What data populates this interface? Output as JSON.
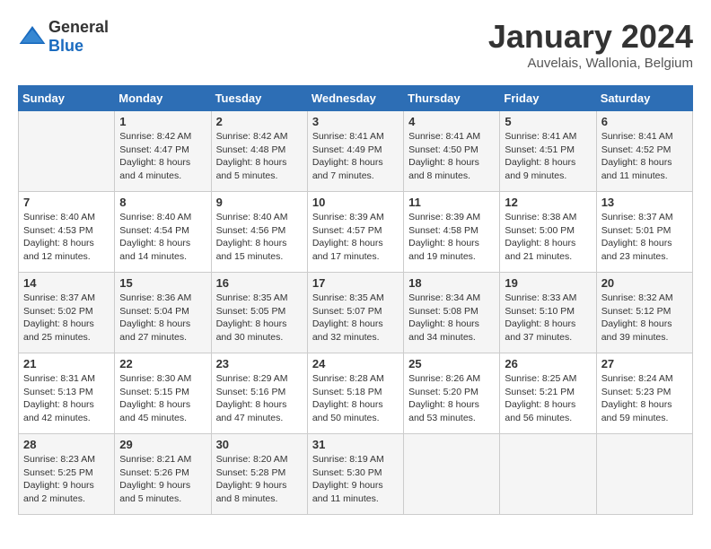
{
  "header": {
    "logo_general": "General",
    "logo_blue": "Blue",
    "month": "January 2024",
    "location": "Auvelais, Wallonia, Belgium"
  },
  "weekdays": [
    "Sunday",
    "Monday",
    "Tuesday",
    "Wednesday",
    "Thursday",
    "Friday",
    "Saturday"
  ],
  "weeks": [
    [
      {
        "day": "",
        "info": ""
      },
      {
        "day": "1",
        "info": "Sunrise: 8:42 AM\nSunset: 4:47 PM\nDaylight: 8 hours\nand 4 minutes."
      },
      {
        "day": "2",
        "info": "Sunrise: 8:42 AM\nSunset: 4:48 PM\nDaylight: 8 hours\nand 5 minutes."
      },
      {
        "day": "3",
        "info": "Sunrise: 8:41 AM\nSunset: 4:49 PM\nDaylight: 8 hours\nand 7 minutes."
      },
      {
        "day": "4",
        "info": "Sunrise: 8:41 AM\nSunset: 4:50 PM\nDaylight: 8 hours\nand 8 minutes."
      },
      {
        "day": "5",
        "info": "Sunrise: 8:41 AM\nSunset: 4:51 PM\nDaylight: 8 hours\nand 9 minutes."
      },
      {
        "day": "6",
        "info": "Sunrise: 8:41 AM\nSunset: 4:52 PM\nDaylight: 8 hours\nand 11 minutes."
      }
    ],
    [
      {
        "day": "7",
        "info": "Sunrise: 8:40 AM\nSunset: 4:53 PM\nDaylight: 8 hours\nand 12 minutes."
      },
      {
        "day": "8",
        "info": "Sunrise: 8:40 AM\nSunset: 4:54 PM\nDaylight: 8 hours\nand 14 minutes."
      },
      {
        "day": "9",
        "info": "Sunrise: 8:40 AM\nSunset: 4:56 PM\nDaylight: 8 hours\nand 15 minutes."
      },
      {
        "day": "10",
        "info": "Sunrise: 8:39 AM\nSunset: 4:57 PM\nDaylight: 8 hours\nand 17 minutes."
      },
      {
        "day": "11",
        "info": "Sunrise: 8:39 AM\nSunset: 4:58 PM\nDaylight: 8 hours\nand 19 minutes."
      },
      {
        "day": "12",
        "info": "Sunrise: 8:38 AM\nSunset: 5:00 PM\nDaylight: 8 hours\nand 21 minutes."
      },
      {
        "day": "13",
        "info": "Sunrise: 8:37 AM\nSunset: 5:01 PM\nDaylight: 8 hours\nand 23 minutes."
      }
    ],
    [
      {
        "day": "14",
        "info": "Sunrise: 8:37 AM\nSunset: 5:02 PM\nDaylight: 8 hours\nand 25 minutes."
      },
      {
        "day": "15",
        "info": "Sunrise: 8:36 AM\nSunset: 5:04 PM\nDaylight: 8 hours\nand 27 minutes."
      },
      {
        "day": "16",
        "info": "Sunrise: 8:35 AM\nSunset: 5:05 PM\nDaylight: 8 hours\nand 30 minutes."
      },
      {
        "day": "17",
        "info": "Sunrise: 8:35 AM\nSunset: 5:07 PM\nDaylight: 8 hours\nand 32 minutes."
      },
      {
        "day": "18",
        "info": "Sunrise: 8:34 AM\nSunset: 5:08 PM\nDaylight: 8 hours\nand 34 minutes."
      },
      {
        "day": "19",
        "info": "Sunrise: 8:33 AM\nSunset: 5:10 PM\nDaylight: 8 hours\nand 37 minutes."
      },
      {
        "day": "20",
        "info": "Sunrise: 8:32 AM\nSunset: 5:12 PM\nDaylight: 8 hours\nand 39 minutes."
      }
    ],
    [
      {
        "day": "21",
        "info": "Sunrise: 8:31 AM\nSunset: 5:13 PM\nDaylight: 8 hours\nand 42 minutes."
      },
      {
        "day": "22",
        "info": "Sunrise: 8:30 AM\nSunset: 5:15 PM\nDaylight: 8 hours\nand 45 minutes."
      },
      {
        "day": "23",
        "info": "Sunrise: 8:29 AM\nSunset: 5:16 PM\nDaylight: 8 hours\nand 47 minutes."
      },
      {
        "day": "24",
        "info": "Sunrise: 8:28 AM\nSunset: 5:18 PM\nDaylight: 8 hours\nand 50 minutes."
      },
      {
        "day": "25",
        "info": "Sunrise: 8:26 AM\nSunset: 5:20 PM\nDaylight: 8 hours\nand 53 minutes."
      },
      {
        "day": "26",
        "info": "Sunrise: 8:25 AM\nSunset: 5:21 PM\nDaylight: 8 hours\nand 56 minutes."
      },
      {
        "day": "27",
        "info": "Sunrise: 8:24 AM\nSunset: 5:23 PM\nDaylight: 8 hours\nand 59 minutes."
      }
    ],
    [
      {
        "day": "28",
        "info": "Sunrise: 8:23 AM\nSunset: 5:25 PM\nDaylight: 9 hours\nand 2 minutes."
      },
      {
        "day": "29",
        "info": "Sunrise: 8:21 AM\nSunset: 5:26 PM\nDaylight: 9 hours\nand 5 minutes."
      },
      {
        "day": "30",
        "info": "Sunrise: 8:20 AM\nSunset: 5:28 PM\nDaylight: 9 hours\nand 8 minutes."
      },
      {
        "day": "31",
        "info": "Sunrise: 8:19 AM\nSunset: 5:30 PM\nDaylight: 9 hours\nand 11 minutes."
      },
      {
        "day": "",
        "info": ""
      },
      {
        "day": "",
        "info": ""
      },
      {
        "day": "",
        "info": ""
      }
    ]
  ]
}
